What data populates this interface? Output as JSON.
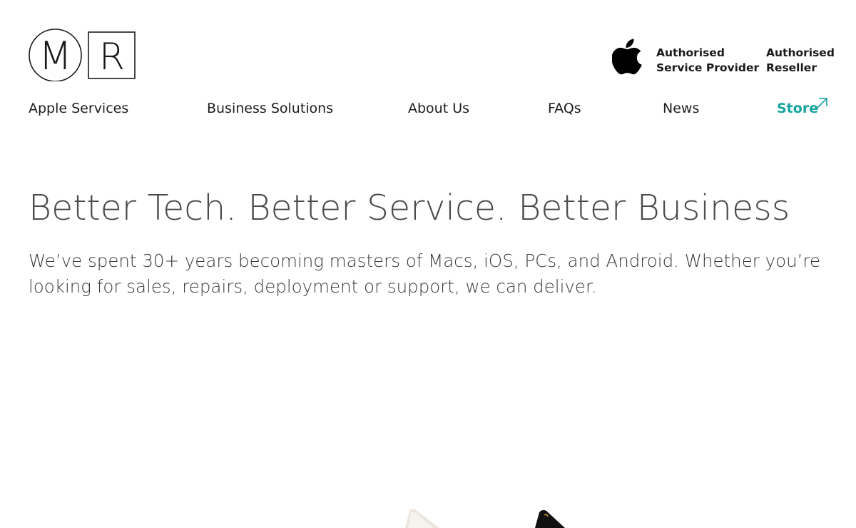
{
  "brand": {
    "logo_letter_left": "M",
    "logo_letter_right": "R",
    "logo_icon": "mr-logo"
  },
  "badges": {
    "apple_icon": "apple-logo-icon",
    "service_provider": [
      "Authorised",
      "Service Provider"
    ],
    "reseller": [
      "Authorised",
      "Reseller"
    ]
  },
  "nav": {
    "items": [
      {
        "label": "Apple Services"
      },
      {
        "label": "Business Solutions"
      },
      {
        "label": "About Us"
      },
      {
        "label": "FAQs"
      },
      {
        "label": "News"
      },
      {
        "label": "Store",
        "icon": "external-arrow-icon"
      }
    ]
  },
  "hero": {
    "title": "Better Tech. Better Service. Better Business",
    "subtitle": "We’ve spent 30+ years becoming masters of Macs, iOS, PCs, and Android. Whether you’re looking for sales, repairs, deployment or support, we can deliver."
  },
  "colors": {
    "accent": "#15a3a0",
    "text": "#1d1d1d",
    "heading": "#4a4a4a"
  }
}
